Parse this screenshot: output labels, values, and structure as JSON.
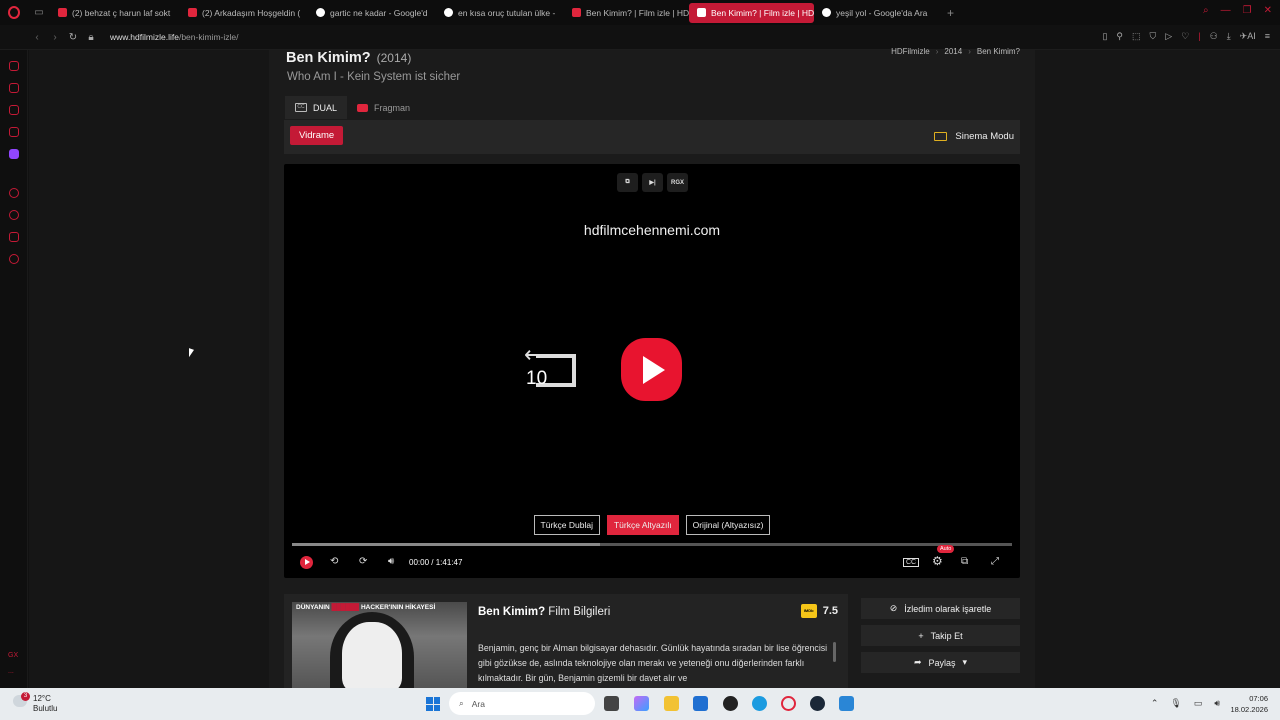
{
  "browser": {
    "tabs": [
      {
        "label": "(2) behzat ç harun laf sokt",
        "favicon_color": "#e0263d"
      },
      {
        "label": "(2) Arkadaşım Hoşgeldin (",
        "favicon_color": "#e0263d"
      },
      {
        "label": "gartic ne kadar - Google'd",
        "favicon_color": "#ffffff"
      },
      {
        "label": "en kısa oruç tutulan ülke -",
        "favicon_color": "#ffffff"
      },
      {
        "label": "Ben Kimim? | Film izle | HD",
        "favicon_color": "#e0263d"
      },
      {
        "label": "Ben Kimim? | Film izle | HD",
        "favicon_color": "#e0263d",
        "active": true
      },
      {
        "label": "yeşil yol - Google'da Ara",
        "favicon_color": "#ffffff"
      }
    ],
    "new_tab": "+",
    "url_host": "www.hdfilmizle.life",
    "url_path": "/ben-kimim-izle/",
    "ai_label": "AI"
  },
  "sidebar": {
    "bottom_label": "GX",
    "more_label": "..."
  },
  "movie": {
    "title": "Ben Kimim?",
    "year": "(2014)",
    "subtitle": "Who Am I - Kein System ist sicher",
    "breadcrumb": [
      "HDFilmizle",
      "2014",
      "Ben Kimim?"
    ],
    "tabs": [
      {
        "label": "DUAL",
        "icon": "cc-icon"
      },
      {
        "label": "Fragman",
        "icon": "youtube-icon"
      }
    ],
    "source_button": "Vidrame",
    "cinema_mode": "Sinema Modu"
  },
  "player": {
    "top_buttons": [
      "external-icon",
      "next-icon",
      "RGX"
    ],
    "watermark": "hdfilmcehennemi.com",
    "rewind_seconds": "10",
    "languages": [
      {
        "label": "Türkçe Dublaj",
        "selected": false
      },
      {
        "label": "Türkçe Altyazılı",
        "selected": true
      },
      {
        "label": "Orijinal (Altyazısız)",
        "selected": false
      }
    ],
    "current_time": "00:00",
    "separator": "/",
    "duration": "1:41:47",
    "buffered_fraction": 0.428,
    "quality_badge": "Auto",
    "accent": "#e8142f"
  },
  "info": {
    "title_bold": "Ben Kimim?",
    "title_rest": "Film Bilgileri",
    "imdb_label": "IMDb",
    "imdb_score": "7.5",
    "poster_caption_left": "DÜNYANIN",
    "poster_caption_right": "HACKER'ININ HİKAYESİ",
    "description": "Benjamin, genç bir Alman bilgisayar dehasıdır. Günlük hayatında sıradan bir lise öğrencisi gibi gözükse de, aslında teknolojiye olan merakı ve yeteneği onu diğerlerinden farklı kılmaktadır. Bir gün, Benjamin gizemli bir davet alır ve",
    "actions": [
      {
        "label": "İzledim olarak işaretle",
        "icon": "eye-off-icon"
      },
      {
        "label": "Takip Et",
        "icon": "plus-icon"
      },
      {
        "label": "Paylaş",
        "icon": "share-icon"
      }
    ]
  },
  "taskbar": {
    "weather_temp": "12°C",
    "weather_desc": "Bulutlu",
    "weather_badge": "3",
    "search_placeholder": "Ara",
    "time": "07:06",
    "date": "18.02.2026"
  }
}
